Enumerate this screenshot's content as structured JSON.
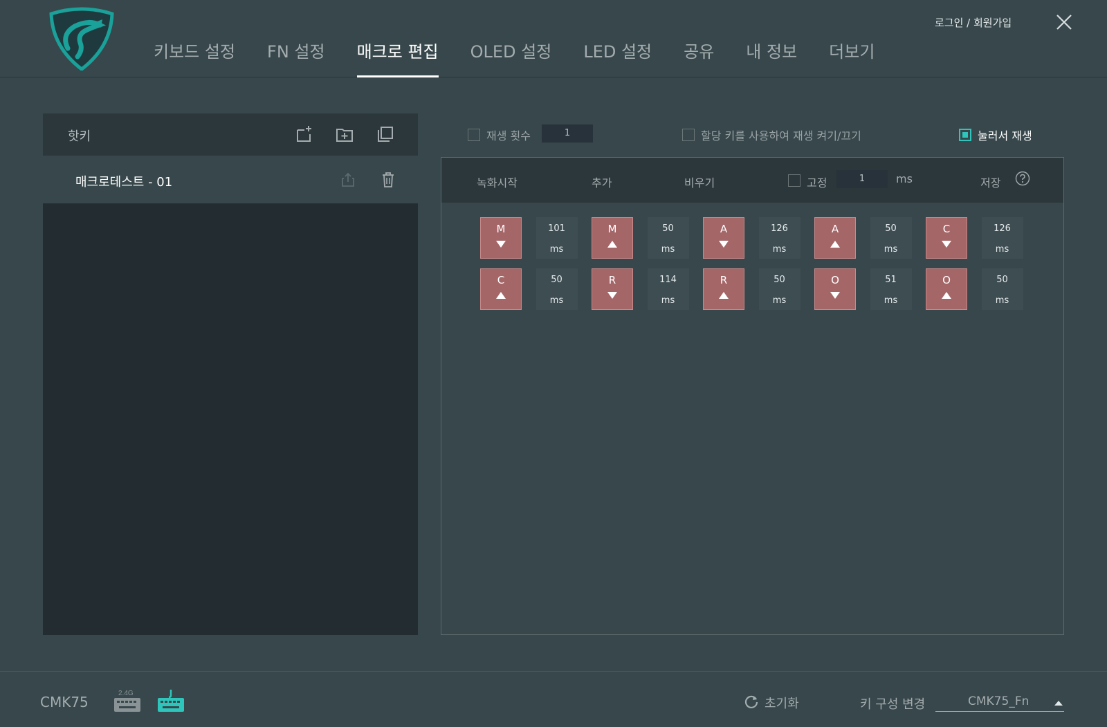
{
  "nav": {
    "tabs": [
      {
        "label": "키보드 설정"
      },
      {
        "label": "FN 설정"
      },
      {
        "label": "매크로 편집",
        "active": true
      },
      {
        "label": "OLED 설정"
      },
      {
        "label": "LED 설정"
      },
      {
        "label": "공유"
      },
      {
        "label": "내 정보"
      },
      {
        "label": "더보기"
      }
    ],
    "login": "로그인 / 회원가입"
  },
  "left": {
    "title": "핫키",
    "macros": [
      {
        "name": "매크로테스트 - 01"
      }
    ]
  },
  "options": {
    "repeat_label": "재생 횟수",
    "repeat_value": "1",
    "toggle_label": "할당 키를 사용하여 재생 켜기/끄기",
    "hold_label": "눌러서 재생"
  },
  "toolbar": {
    "record": "녹화시작",
    "add": "추가",
    "clear": "비우기",
    "fixed": "고정",
    "fixed_value": "1",
    "unit": "ms",
    "save": "저장"
  },
  "events": [
    {
      "key": "M",
      "dir": "down"
    },
    {
      "delay": "101",
      "unit": "ms"
    },
    {
      "key": "M",
      "dir": "up"
    },
    {
      "delay": "50",
      "unit": "ms"
    },
    {
      "key": "A",
      "dir": "down"
    },
    {
      "delay": "126",
      "unit": "ms"
    },
    {
      "key": "A",
      "dir": "up"
    },
    {
      "delay": "50",
      "unit": "ms"
    },
    {
      "key": "C",
      "dir": "down"
    },
    {
      "delay": "126",
      "unit": "ms"
    },
    {
      "key": "C",
      "dir": "up"
    },
    {
      "delay": "50",
      "unit": "ms"
    },
    {
      "key": "R",
      "dir": "down"
    },
    {
      "delay": "114",
      "unit": "ms"
    },
    {
      "key": "R",
      "dir": "up"
    },
    {
      "delay": "50",
      "unit": "ms"
    },
    {
      "key": "O",
      "dir": "down"
    },
    {
      "delay": "51",
      "unit": "ms"
    },
    {
      "key": "O",
      "dir": "up"
    },
    {
      "delay": "50",
      "unit": "ms"
    }
  ],
  "footer": {
    "device": "CMK75",
    "badge_24g": "2.4G",
    "reset": "초기화",
    "config_label": "키 구성 변경",
    "config_value": "CMK75_Fn"
  },
  "colors": {
    "accent": "#2ec6bc",
    "key_bg": "#a56668",
    "background": "#37474b",
    "panel": "#232d31"
  }
}
